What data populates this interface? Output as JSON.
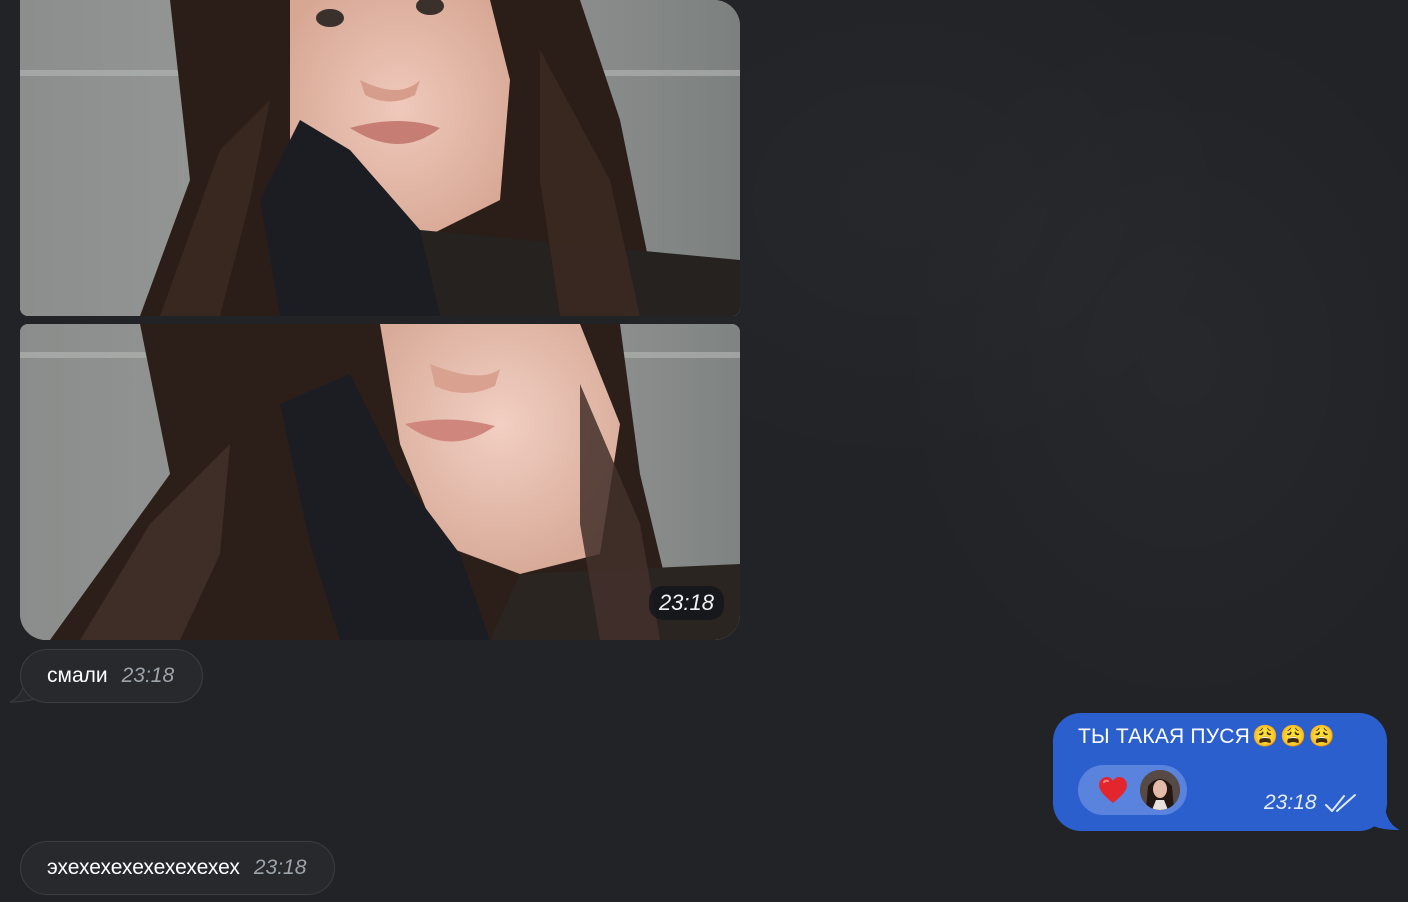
{
  "conversation": {
    "photo_album": {
      "time": "23:18"
    },
    "incoming_messages": [
      {
        "text": "смали",
        "time": "23:18"
      },
      {
        "text": "эхехехехехехехехех",
        "time": "23:18"
      }
    ],
    "outgoing_message": {
      "text": "ТЫ ТАКАЯ ПУСЯ",
      "emoji": [
        "😩",
        "😩",
        "😩"
      ],
      "time": "23:18",
      "status": "read",
      "reaction": {
        "icon": "heart-icon"
      }
    }
  },
  "colors": {
    "background": "#212327",
    "incoming_bubble": "#28292d",
    "outgoing_bubble": "#2c5fce",
    "reaction_pill": "#5a83de"
  }
}
